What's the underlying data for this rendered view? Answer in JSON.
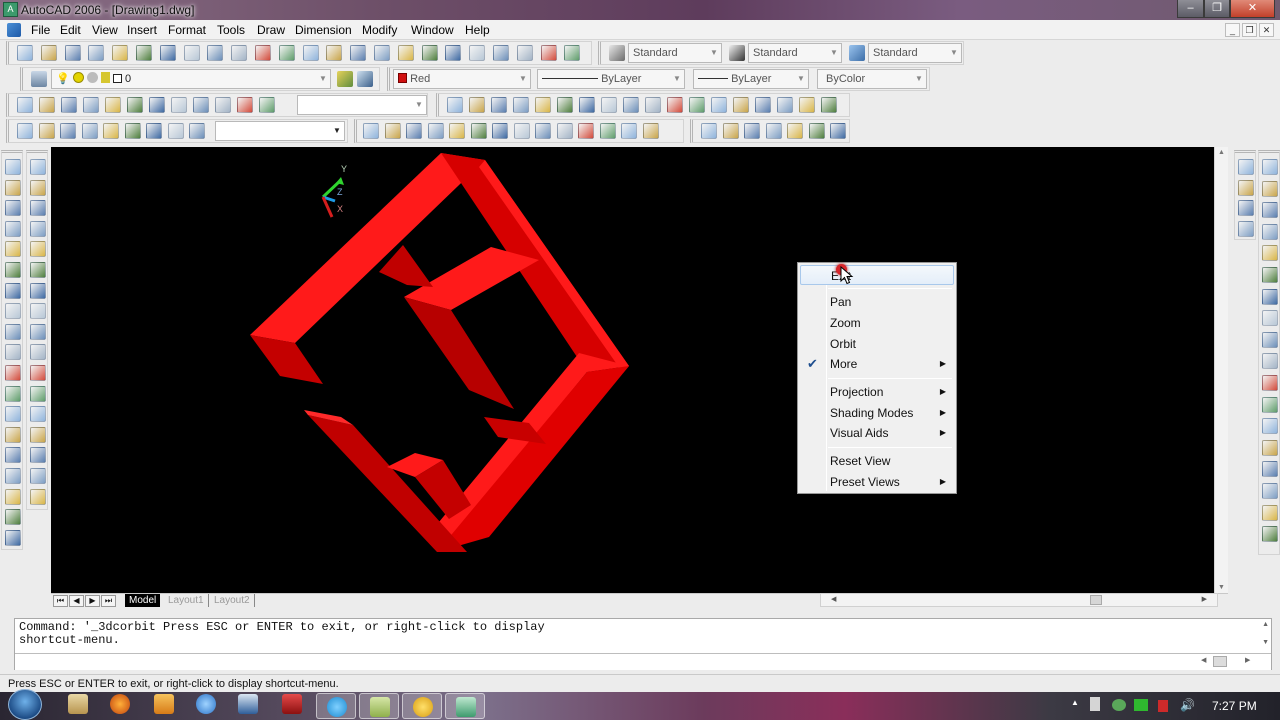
{
  "window": {
    "title": "AutoCAD 2006 - [Drawing1.dwg]",
    "app_icon": "autocad-logo-icon",
    "controls": {
      "minimize": "–",
      "restore": "❐",
      "close": "✕"
    }
  },
  "menubar": {
    "items": [
      "File",
      "Edit",
      "View",
      "Insert",
      "Format",
      "Tools",
      "Draw",
      "Dimension",
      "Modify",
      "Window",
      "Help"
    ],
    "doc_controls": {
      "minimize": "_",
      "restore": "❐",
      "close": "✕"
    }
  },
  "toolbars": {
    "standard": {
      "icons": [
        "qnew-icon",
        "open-icon",
        "save-icon",
        "plot-icon",
        "plot-preview-icon",
        "publish-icon",
        "cut-icon",
        "copy-icon",
        "paste-icon",
        "match-properties-icon",
        "block-editor-icon",
        "undo-icon",
        "redo-icon",
        "pan-realtime-icon",
        "zoom-realtime-icon",
        "zoom-window-icon",
        "zoom-previous-icon",
        "properties-icon",
        "designcenter-icon",
        "tool-palettes-icon",
        "sheet-set-icon",
        "markup-icon",
        "quickcalc-icon",
        "help-icon"
      ]
    },
    "styles": {
      "text_style": "Standard",
      "dim_style": "Standard",
      "table_style": "Standard"
    },
    "layers": {
      "current_layer": "0",
      "layer_state_icons": [
        "on-lightbulb-icon",
        "thaw-sun-icon",
        "viewport-freeze-icon",
        "lock-icon",
        "color-swatch-icon"
      ]
    },
    "properties": {
      "color": "Red",
      "color_swatch": "#d01010",
      "linetype": "ByLayer",
      "lineweight": "ByLayer",
      "plot_style": "ByColor"
    },
    "view_combo": "",
    "ucs_combo": ""
  },
  "left_toolbar_draw": [
    "line-icon",
    "construction-line-icon",
    "polyline-icon",
    "polygon-icon",
    "rectangle-icon",
    "arc-icon",
    "circle-icon",
    "revision-cloud-icon",
    "spline-icon",
    "ellipse-icon",
    "ellipse-arc-icon",
    "insert-block-icon",
    "make-block-icon",
    "point-icon",
    "hatch-icon",
    "gradient-icon",
    "region-icon",
    "table-icon",
    "multiline-text-icon"
  ],
  "left_toolbar_modify": [
    "erase-icon",
    "copy-object-icon",
    "mirror-icon",
    "offset-icon",
    "array-icon",
    "move-icon",
    "rotate-icon",
    "scale-icon",
    "stretch-icon",
    "trim-icon",
    "extend-icon",
    "break-at-point-icon",
    "break-icon",
    "join-icon",
    "chamfer-icon",
    "fillet-icon",
    "explode-icon"
  ],
  "right_toolbar_draworder": [
    "bring-to-front-icon",
    "send-to-back-icon",
    "bring-above-icon",
    "send-under-icon"
  ],
  "right_toolbar_dimension": [
    "linear-dim-icon",
    "aligned-dim-icon",
    "arc-length-icon",
    "ordinate-icon",
    "radius-icon",
    "jogged-icon",
    "diameter-icon",
    "angular-icon",
    "quick-dim-icon",
    "baseline-icon",
    "continue-icon",
    "quick-leader-icon",
    "tolerance-icon",
    "center-mark-icon",
    "dim-edit-icon",
    "dim-text-edit-icon",
    "dim-update-icon",
    "dim-style-icon"
  ],
  "viewport": {
    "background": "#000000",
    "model_color": "#ff1a1a",
    "ucs_labels": {
      "x": "X",
      "y": "Y",
      "z": "Z"
    }
  },
  "context_menu": {
    "items": [
      {
        "label": "Exit",
        "highlighted": true
      },
      {
        "label": "Pan"
      },
      {
        "label": "Zoom"
      },
      {
        "label": "Orbit"
      },
      {
        "label": "More",
        "checked": true,
        "submenu": true
      },
      {
        "label": "Projection",
        "submenu": true
      },
      {
        "label": "Shading Modes",
        "submenu": true
      },
      {
        "label": "Visual Aids",
        "submenu": true
      },
      {
        "label": "Reset View"
      },
      {
        "label": "Preset Views",
        "submenu": true
      }
    ],
    "check_glyph": "✔",
    "arrow_glyph": "▶"
  },
  "layout_tabs": {
    "nav": [
      "⏮",
      "◀",
      "▶",
      "⏭"
    ],
    "tabs": [
      "Model",
      "Layout1",
      "Layout2"
    ],
    "active": "Model"
  },
  "command_window": {
    "history": "Command: '_3dcorbit Press ESC or ENTER to exit, or right-click to display\nshortcut-menu.",
    "input": ""
  },
  "status_bar": {
    "text": "Press ESC or ENTER to exit, or right-click to display shortcut-menu."
  },
  "taskbar": {
    "apps": [
      "start-orb",
      "windows-explorer-icon",
      "firefox-icon",
      "media-player-icon",
      "internet-explorer-icon",
      "nero-icon",
      "solidworks-icon",
      "skype-icon",
      "notepad-icon",
      "paint-icon",
      "autocad-icon"
    ],
    "clock": "7:27 PM",
    "tray_icons": [
      "show-hidden-icons",
      "power-icon",
      "network-icon",
      "sync-icon",
      "signal-icon",
      "volume-icon"
    ]
  }
}
